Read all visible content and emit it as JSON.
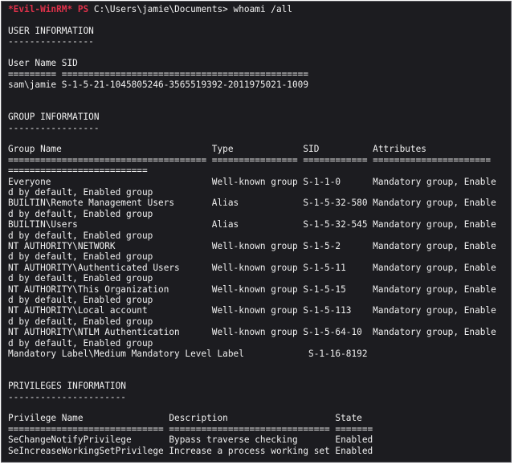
{
  "prompt": {
    "shell_name": "*Evil-WinRM*",
    "ps_label": "PS",
    "path_and_command": "C:\\Users\\jamie\\Documents> whoami /all"
  },
  "user_info": {
    "heading": "USER INFORMATION",
    "underline": "----------------",
    "columns_header": "User Name SID",
    "columns_rule": "========= ==============================================",
    "row": "sam\\jamie S-1-5-21-1045805246-3565519392-2011975021-1009"
  },
  "group_info": {
    "heading": "GROUP INFORMATION",
    "underline": "-----------------",
    "columns_header": "Group Name                            Type             SID          Attributes",
    "columns_rule_1": "===================================== ================ ============ ======================",
    "columns_rule_2": "==========================",
    "rows": [
      "Everyone                              Well-known group S-1-1-0      Mandatory group, Enable",
      "d by default, Enabled group",
      "BUILTIN\\Remote Management Users       Alias            S-1-5-32-580 Mandatory group, Enable",
      "d by default, Enabled group",
      "BUILTIN\\Users                         Alias            S-1-5-32-545 Mandatory group, Enable",
      "d by default, Enabled group",
      "NT AUTHORITY\\NETWORK                  Well-known group S-1-5-2      Mandatory group, Enable",
      "d by default, Enabled group",
      "NT AUTHORITY\\Authenticated Users      Well-known group S-1-5-11     Mandatory group, Enable",
      "d by default, Enabled group",
      "NT AUTHORITY\\This Organization        Well-known group S-1-5-15     Mandatory group, Enable",
      "d by default, Enabled group",
      "NT AUTHORITY\\Local account            Well-known group S-1-5-113    Mandatory group, Enable",
      "d by default, Enabled group",
      "NT AUTHORITY\\NTLM Authentication      Well-known group S-1-5-64-10  Mandatory group, Enable",
      "d by default, Enabled group",
      "Mandatory Label\\Medium Mandatory Level Label            S-1-16-8192"
    ]
  },
  "privileges_info": {
    "heading": "PRIVILEGES INFORMATION",
    "underline": "----------------------",
    "columns_header": "Privilege Name                Description                    State",
    "columns_rule": "============================= ============================== =======",
    "rows": [
      "SeChangeNotifyPrivilege       Bypass traverse checking       Enabled",
      "SeIncreaseWorkingSetPrivilege Increase a process working set Enabled"
    ]
  }
}
